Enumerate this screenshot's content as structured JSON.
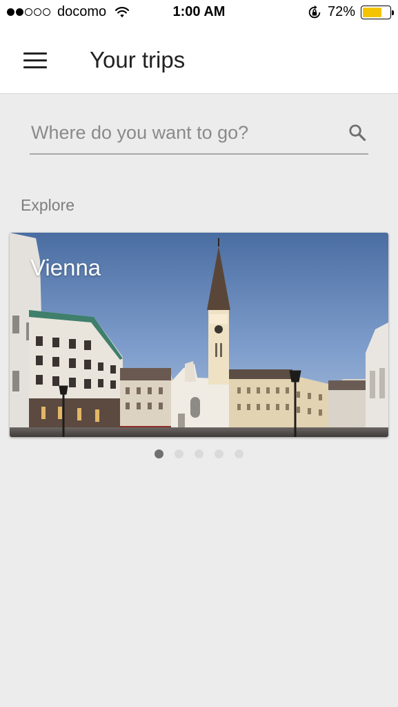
{
  "status_bar": {
    "signal_filled": 2,
    "signal_total": 5,
    "carrier": "docomo",
    "time": "1:00 AM",
    "battery_percent": "72%",
    "battery_level": 0.72,
    "battery_color": "#f5c400"
  },
  "app_bar": {
    "menu_icon": "hamburger-menu-icon",
    "title": "Your trips"
  },
  "search": {
    "placeholder": "Where do you want to go?",
    "value": "",
    "icon": "search-icon"
  },
  "explore": {
    "label": "Explore",
    "cards": [
      {
        "title": "Vienna"
      }
    ],
    "pager": {
      "count": 5,
      "active_index": 0,
      "active_color": "#707070",
      "inactive_color": "#dadada"
    }
  }
}
